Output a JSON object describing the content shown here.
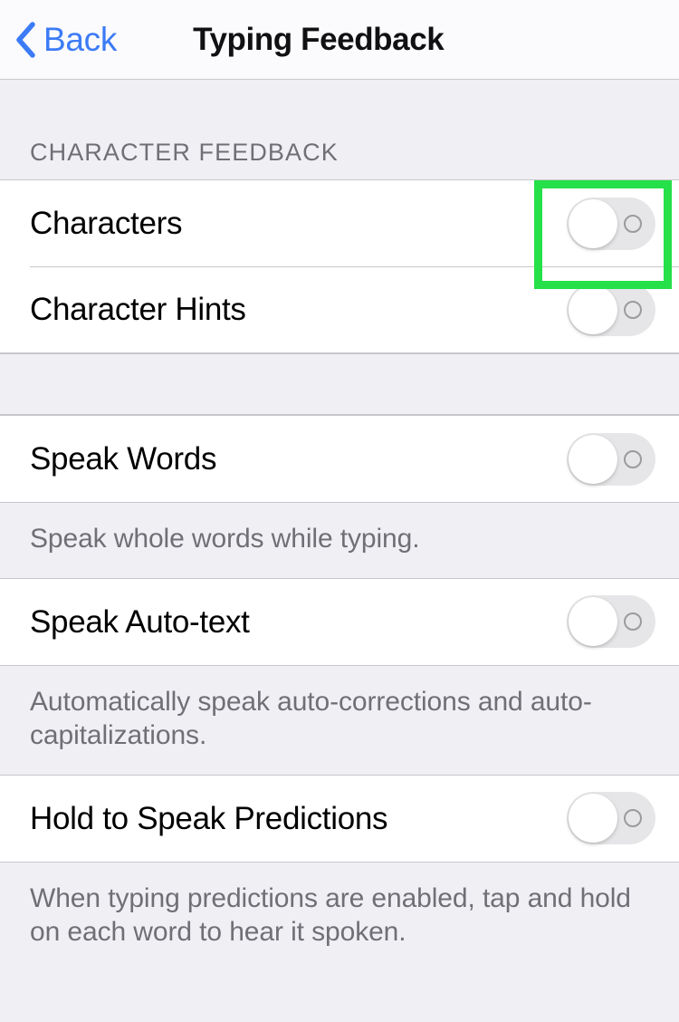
{
  "navbar": {
    "back_label": "Back",
    "back_icon": "chevron-left-icon",
    "title": "Typing Feedback",
    "accent_color": "#3c7bf6"
  },
  "sections": [
    {
      "header": "CHARACTER FEEDBACK",
      "rows": [
        {
          "label": "Characters",
          "toggle": "off",
          "highlighted": true
        },
        {
          "label": "Character Hints",
          "toggle": "off",
          "highlighted": false
        }
      ],
      "footer": ""
    },
    {
      "header": "",
      "rows": [
        {
          "label": "Speak Words",
          "toggle": "off",
          "highlighted": false
        }
      ],
      "footer": "Speak whole words while typing."
    },
    {
      "header": "",
      "rows": [
        {
          "label": "Speak Auto-text",
          "toggle": "off",
          "highlighted": false
        }
      ],
      "footer": "Automatically speak auto-corrections and auto-capitalizations."
    },
    {
      "header": "",
      "rows": [
        {
          "label": "Hold to Speak Predictions",
          "toggle": "off",
          "highlighted": false
        }
      ],
      "footer": "When typing predictions are enabled, tap and hold on each word to hear it spoken."
    }
  ],
  "highlight": {
    "target": "characters-toggle",
    "color": "#25e048"
  }
}
